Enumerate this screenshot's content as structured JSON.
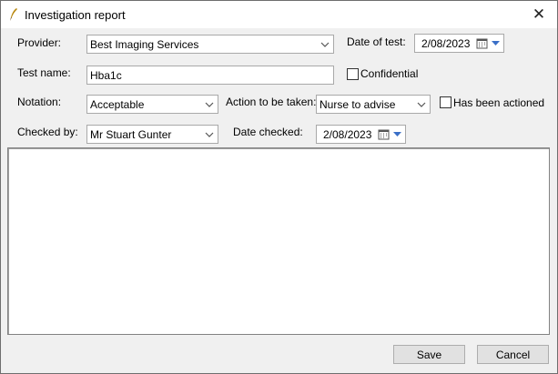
{
  "window": {
    "title": "Investigation report",
    "close_glyph": "✕",
    "icon": "quill-icon"
  },
  "provider": {
    "label": "Provider:",
    "value": "Best Imaging Services"
  },
  "date_of_test": {
    "label": "Date of test:",
    "value": "2/08/2023"
  },
  "test_name": {
    "label": "Test name:",
    "value": "Hba1c"
  },
  "confidential": {
    "label": "Confidential",
    "checked": false
  },
  "notation": {
    "label": "Notation:",
    "value": "Acceptable"
  },
  "action": {
    "label": "Action to be taken:",
    "value": "Nurse to advise"
  },
  "has_been_actioned": {
    "label": "Has been actioned",
    "checked": false
  },
  "checked_by": {
    "label": "Checked by:",
    "value": "Mr Stuart Gunter"
  },
  "date_checked": {
    "label": "Date checked:",
    "value": "2/08/2023"
  },
  "notes": {
    "value": ""
  },
  "buttons": {
    "save": "Save",
    "cancel": "Cancel"
  }
}
